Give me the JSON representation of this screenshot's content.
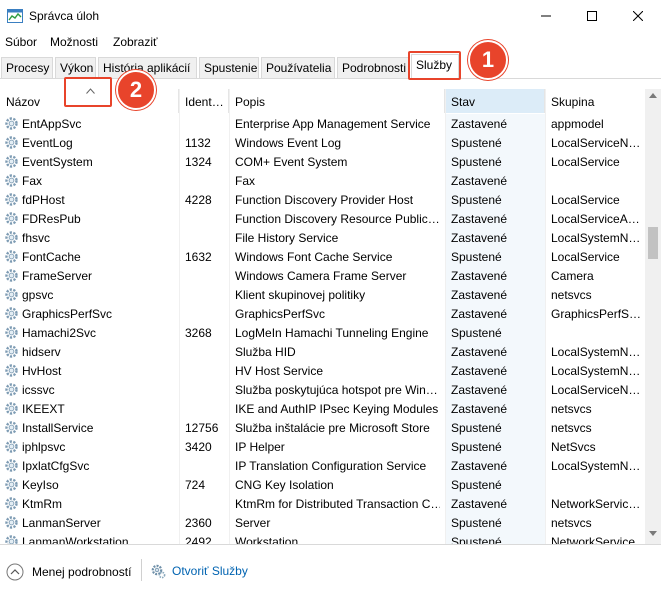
{
  "window": {
    "title": "Správca úloh"
  },
  "menu": [
    "Súbor",
    "Možnosti",
    "Zobraziť"
  ],
  "tabs": [
    "Procesy",
    "Výkon",
    "História aplikácií",
    "Spustenie",
    "Používatelia",
    "Podrobnosti",
    "Služby"
  ],
  "active_tab": "Služby",
  "callouts": {
    "one": "1",
    "two": "2"
  },
  "accent_color": "#e8442b",
  "columns": {
    "name": "Názov",
    "pid": "Ident…",
    "desc": "Popis",
    "status": "Stav",
    "group": "Skupina"
  },
  "services": [
    [
      "EntAppSvc",
      "",
      "Enterprise App Management Service",
      "Zastavené",
      "appmodel"
    ],
    [
      "EventLog",
      "1132",
      "Windows Event Log",
      "Spustené",
      "LocalServiceN…"
    ],
    [
      "EventSystem",
      "1324",
      "COM+ Event System",
      "Spustené",
      "LocalService"
    ],
    [
      "Fax",
      "",
      "Fax",
      "Zastavené",
      ""
    ],
    [
      "fdPHost",
      "4228",
      "Function Discovery Provider Host",
      "Spustené",
      "LocalService"
    ],
    [
      "FDResPub",
      "",
      "Function Discovery Resource Public…",
      "Zastavené",
      "LocalServiceA…"
    ],
    [
      "fhsvc",
      "",
      "File History Service",
      "Zastavené",
      "LocalSystemN…"
    ],
    [
      "FontCache",
      "1632",
      "Windows Font Cache Service",
      "Spustené",
      "LocalService"
    ],
    [
      "FrameServer",
      "",
      "Windows Camera Frame Server",
      "Zastavené",
      "Camera"
    ],
    [
      "gpsvc",
      "",
      "Klient skupinovej politiky",
      "Zastavené",
      "netsvcs"
    ],
    [
      "GraphicsPerfSvc",
      "",
      "GraphicsPerfSvc",
      "Zastavené",
      "GraphicsPerfS…"
    ],
    [
      "Hamachi2Svc",
      "3268",
      "LogMeIn Hamachi Tunneling Engine",
      "Spustené",
      ""
    ],
    [
      "hidserv",
      "",
      "Služba HID",
      "Zastavené",
      "LocalSystemN…"
    ],
    [
      "HvHost",
      "",
      "HV Host Service",
      "Zastavené",
      "LocalSystemN…"
    ],
    [
      "icssvc",
      "",
      "Služba poskytujúca hotspot pre Win…",
      "Zastavené",
      "LocalServiceN…"
    ],
    [
      "IKEEXT",
      "",
      "IKE and AuthIP IPsec Keying Modules",
      "Zastavené",
      "netsvcs"
    ],
    [
      "InstallService",
      "12756",
      "Služba inštalácie pre Microsoft Store",
      "Spustené",
      "netsvcs"
    ],
    [
      "iphlpsvc",
      "3420",
      "IP Helper",
      "Spustené",
      "NetSvcs"
    ],
    [
      "IpxlatCfgSvc",
      "",
      "IP Translation Configuration Service",
      "Zastavené",
      "LocalSystemN…"
    ],
    [
      "KeyIso",
      "724",
      "CNG Key Isolation",
      "Spustené",
      ""
    ],
    [
      "KtmRm",
      "",
      "KtmRm for Distributed Transaction C…",
      "Zastavené",
      "NetworkServic…"
    ],
    [
      "LanmanServer",
      "2360",
      "Server",
      "Spustené",
      "netsvcs"
    ],
    [
      "LanmanWorkstation",
      "2492",
      "Workstation",
      "Spustené",
      "NetworkService"
    ]
  ],
  "footer": {
    "less_details": "Menej podrobností",
    "open_services": "Otvoriť Služby"
  }
}
